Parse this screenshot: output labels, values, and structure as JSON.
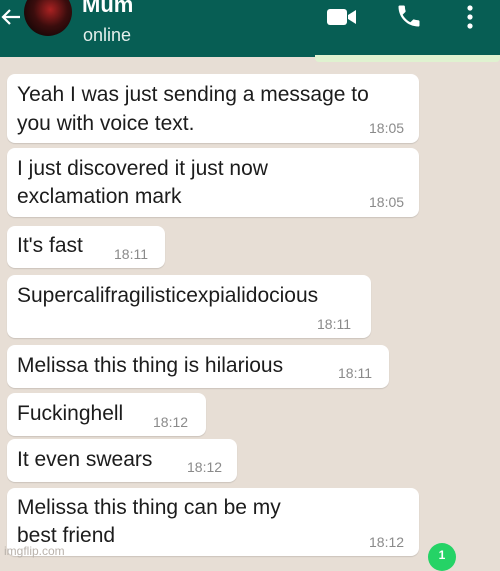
{
  "header": {
    "contact_name": "Mum",
    "status": "online",
    "icons": {
      "back": "back-arrow-icon",
      "video": "video-call-icon",
      "call": "phone-call-icon",
      "menu": "more-options-icon"
    },
    "color": "#075e54"
  },
  "messages": [
    {
      "lines": [
        "Yeah I was just sending a message to",
        "you with voice text."
      ],
      "time": "18:05"
    },
    {
      "lines": [
        "I just discovered it just now",
        "exclamation mark"
      ],
      "time": "18:05"
    },
    {
      "lines": [
        "It's fast"
      ],
      "time": "18:11"
    },
    {
      "lines": [
        "Supercalifragilisticexpialidocious"
      ],
      "time": "18:11"
    },
    {
      "lines": [
        "Melissa this thing is hilarious"
      ],
      "time": "18:11"
    },
    {
      "lines": [
        "Fuckinghell"
      ],
      "time": "18:12"
    },
    {
      "lines": [
        "It even swears"
      ],
      "time": "18:12"
    },
    {
      "lines": [
        "Melissa this thing can be my",
        "best friend"
      ],
      "time": "18:12"
    }
  ],
  "unread_badge": "1",
  "watermark": "imgflip.com",
  "colors": {
    "chat_background": "#e7ded5",
    "bubble": "#ffffff",
    "badge": "#25d366"
  }
}
